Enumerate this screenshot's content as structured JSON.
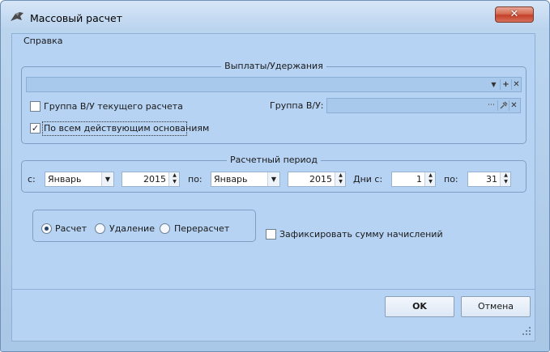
{
  "window": {
    "title": "Массовый расчет",
    "close_glyph": "✕"
  },
  "menu": {
    "help": "Справка"
  },
  "payments_group": {
    "legend": "Выплаты/Удержания",
    "selector_value": "",
    "own_group_checkbox": {
      "label": "Группа В/У текущего расчета",
      "checked": false
    },
    "all_bases_checkbox": {
      "label": "По всем действующим основаниям",
      "checked": true
    },
    "group_field_label": "Группа В/У:",
    "group_field_value": ""
  },
  "period_group": {
    "legend": "Расчетный период",
    "from_label": "с:",
    "from_month": "Январь",
    "from_year": "2015",
    "to_label": "по:",
    "to_month": "Январь",
    "to_year": "2015",
    "days_from_label": "Дни с:",
    "days_from": "1",
    "days_to_label": "по:",
    "days_to": "31"
  },
  "mode": {
    "options": [
      {
        "label": "Расчет",
        "checked": true
      },
      {
        "label": "Удаление",
        "checked": false
      },
      {
        "label": "Перерасчет",
        "checked": false
      }
    ],
    "fix_sum_checkbox": {
      "label": "Зафиксировать сумму начислений",
      "checked": false
    }
  },
  "buttons": {
    "ok": "OK",
    "cancel": "Отмена"
  },
  "colors": {
    "window_bg": "#b6d3f3",
    "close_button": "#c4402a",
    "field_bg": "#a8c8ec"
  }
}
